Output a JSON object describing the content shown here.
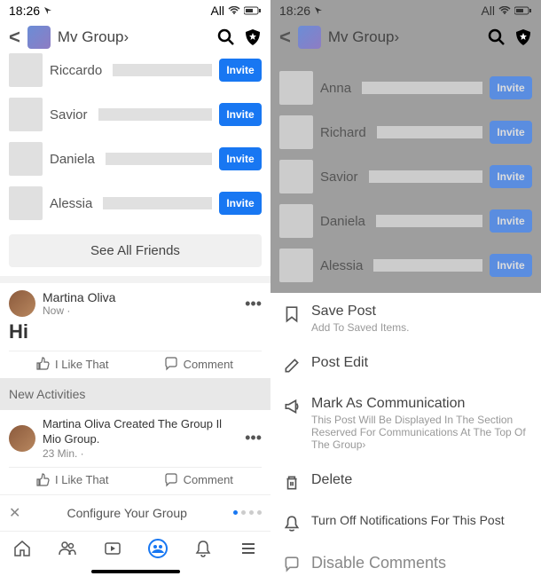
{
  "status": {
    "time": "18:26",
    "right": "All"
  },
  "header": {
    "title": "Mv Group›"
  },
  "left": {
    "friends": [
      {
        "name": "Riccardo",
        "btn": "Invite"
      },
      {
        "name": "Savior",
        "btn": "Invite"
      },
      {
        "name": "Daniela",
        "btn": "Invite"
      },
      {
        "name": "Alessia",
        "btn": "Invite"
      }
    ],
    "see_all": "See All Friends",
    "post1": {
      "author": "Martina Oliva",
      "time": "Now ·",
      "content": "Hi",
      "like": "I Like That",
      "comment": "Comment"
    },
    "new_activities": "New Activities",
    "post2": {
      "author": "Martina Oliva Created The Group Il Mio Group.",
      "time": "23 Min. ·",
      "like": "I Like That",
      "comment": "Comment"
    },
    "configure": "Configure Your Group"
  },
  "right": {
    "friends": [
      {
        "name": "Anna",
        "btn": "Invite"
      },
      {
        "name": "Richard",
        "btn": "Invite"
      },
      {
        "name": "Savior",
        "btn": "Invite"
      },
      {
        "name": "Daniela",
        "btn": "Invite"
      },
      {
        "name": "Alessia",
        "btn": "Invite"
      }
    ],
    "sheet": {
      "save": {
        "title": "Save Post",
        "sub": "Add To Saved Items."
      },
      "edit": {
        "title": "Post Edit"
      },
      "mark": {
        "title": "Mark As Communication",
        "sub": "This Post Will Be Displayed In The Section Reserved For Communications At The Top Of The Group›"
      },
      "delete": {
        "title": "Delete"
      },
      "notif": {
        "title": "Turn Off Notifications For This Post"
      },
      "disable": {
        "title": "Disable Comments"
      }
    }
  }
}
